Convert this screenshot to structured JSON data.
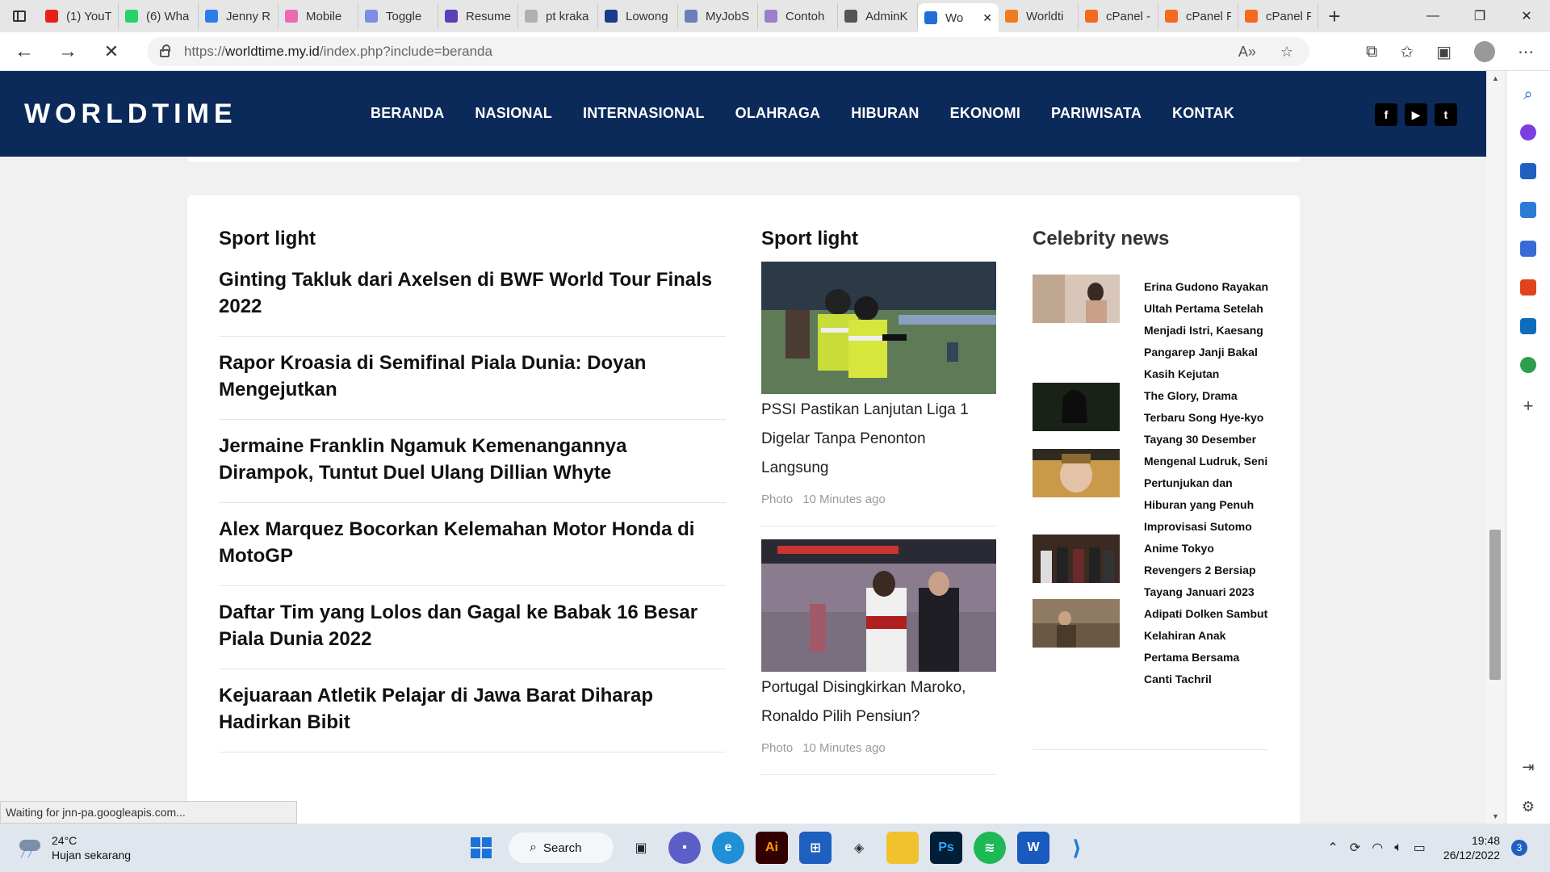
{
  "browser": {
    "tabs": [
      {
        "label": "(1) YouT",
        "color": "#e62117"
      },
      {
        "label": "(6) Wha",
        "color": "#25d366"
      },
      {
        "label": "Jenny R",
        "color": "#2b7de9"
      },
      {
        "label": "Mobile",
        "color": "#e96bb0"
      },
      {
        "label": "Toggle",
        "color": "#7b8fe0"
      },
      {
        "label": "Resume",
        "color": "#5b3fb5"
      },
      {
        "label": "pt kraka",
        "color": "#b0b0b0"
      },
      {
        "label": "Lowong",
        "color": "#1a3a8a"
      },
      {
        "label": "MyJobS",
        "color": "#6a7fb8"
      },
      {
        "label": "Contoh",
        "color": "#9b7fc9"
      },
      {
        "label": "AdminK",
        "color": "#555555"
      },
      {
        "label": "Wo",
        "color": "#1f6fd6",
        "active": true
      },
      {
        "label": "Worldti",
        "color": "#f07b1e"
      },
      {
        "label": "cPanel -",
        "color": "#f26b21"
      },
      {
        "label": "cPanel F",
        "color": "#f26b21"
      },
      {
        "label": "cPanel F",
        "color": "#f26b21"
      }
    ],
    "url_prefix": "https://",
    "url_domain": "worldtime.my.id",
    "url_path": "/index.php?include=beranda",
    "status_text": "Waiting for jnn-pa.googleapis.com..."
  },
  "site": {
    "logo": "WORLDTIME",
    "nav": [
      "BERANDA",
      "NASIONAL",
      "INTERNASIONAL",
      "OLAHRAGA",
      "HIBURAN",
      "EKONOMI",
      "PARIWISATA",
      "KONTAK"
    ],
    "socials": [
      "facebook-icon",
      "youtube-icon",
      "twitter-icon"
    ],
    "brand_color": "#0b2a5a"
  },
  "sport_list": {
    "title": "Sport light",
    "items": [
      "Ginting Takluk dari Axelsen di BWF World Tour Finals 2022",
      "Rapor Kroasia di Semifinal Piala Dunia: Doyan Mengejutkan",
      "Jermaine Franklin Ngamuk Kemenangannya Dirampok, Tuntut Duel Ulang Dillian Whyte",
      "Alex Marquez Bocorkan Kelemahan Motor Honda di MotoGP",
      "Daftar Tim yang Lolos dan Gagal ke Babak 16 Besar Piala Dunia 2022",
      "Kejuaraan Atletik Pelajar di Jawa Barat Diharap Hadirkan Bibit"
    ]
  },
  "sport_photo": {
    "title": "Sport light",
    "items": [
      {
        "title": "PSSI Pastikan Lanjutan Liga 1 Digelar Tanpa Penonton Langsung",
        "category": "Photo",
        "time": "10 Minutes ago"
      },
      {
        "title": "Portugal Disingkirkan Maroko, Ronaldo Pilih Pensiun?",
        "category": "Photo",
        "time": "10 Minutes ago"
      }
    ]
  },
  "celebrity": {
    "title": "Celebrity news",
    "lines": [
      "Erina Gudono Rayakan",
      "Ultah Pertama Setelah",
      "Menjadi Istri, Kaesang",
      "Pangarep Janji Bakal",
      "Kasih Kejutan",
      "The Glory, Drama",
      "Terbaru Song Hye-kyo",
      "Tayang 30 Desember",
      "Mengenal Ludruk, Seni",
      "Pertunjukan dan",
      "Hiburan yang Penuh",
      "Improvisasi Sutomo",
      "Anime Tokyo",
      "Revengers 2 Bersiap",
      "Tayang Januari 2023",
      "Adipati Dolken Sambut",
      "Kelahiran Anak",
      "Pertama Bersama",
      "Canti Tachril"
    ]
  },
  "taskbar": {
    "temperature": "24°C",
    "weather": "Hujan sekarang",
    "search_label": "Search",
    "time": "19:48",
    "date": "26/12/2022",
    "notifications": "3"
  }
}
